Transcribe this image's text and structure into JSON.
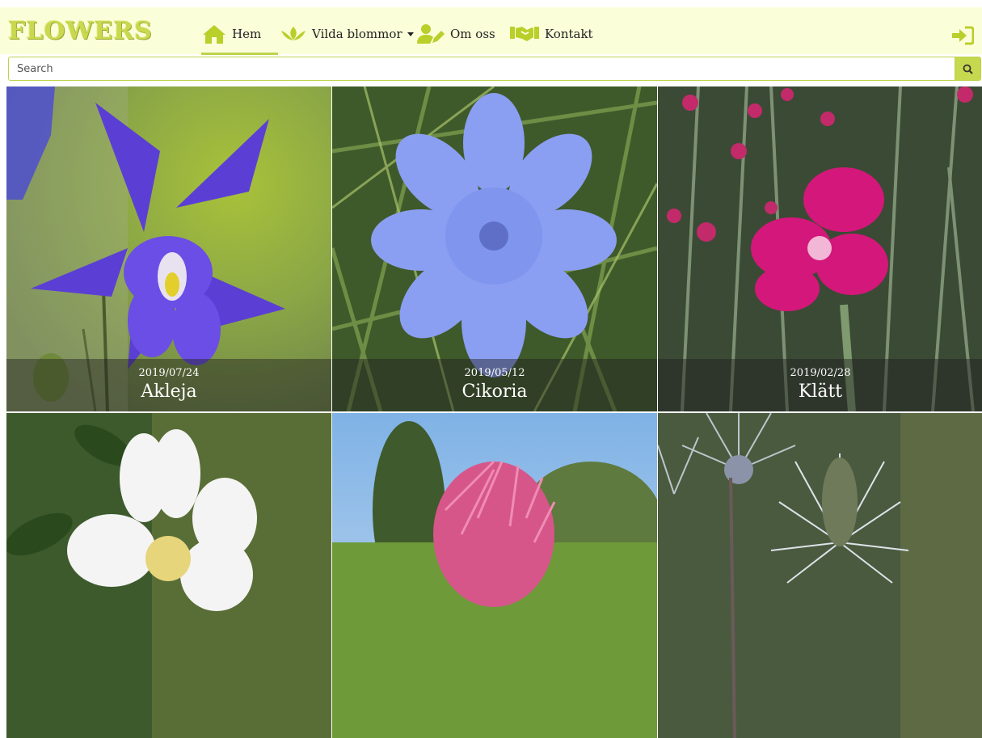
{
  "brand": {
    "logo_text": "FLOWERS"
  },
  "nav": {
    "items": [
      {
        "label": "Hem",
        "icon": "home-icon",
        "active": true
      },
      {
        "label": "Vilda blommor",
        "icon": "lotus-icon",
        "dropdown": true
      },
      {
        "label": "Om oss",
        "icon": "user-edit-icon"
      },
      {
        "label": "Kontakt",
        "icon": "handshake-icon"
      }
    ],
    "login_icon": "sign-in-icon"
  },
  "search": {
    "placeholder": "Search",
    "value": "",
    "button_icon": "search-icon"
  },
  "colors": {
    "navbar_bg": "#fbffd9",
    "accent": "#bdd34b",
    "icon": "#b9cf2a"
  },
  "flowers": [
    {
      "date": "2019/07/24",
      "name": "Akleja"
    },
    {
      "date": "2019/05/12",
      "name": "Cikoria"
    },
    {
      "date": "2019/02/28",
      "name": "Klätt"
    },
    {
      "date": "",
      "name": ""
    },
    {
      "date": "",
      "name": ""
    },
    {
      "date": "",
      "name": ""
    }
  ]
}
